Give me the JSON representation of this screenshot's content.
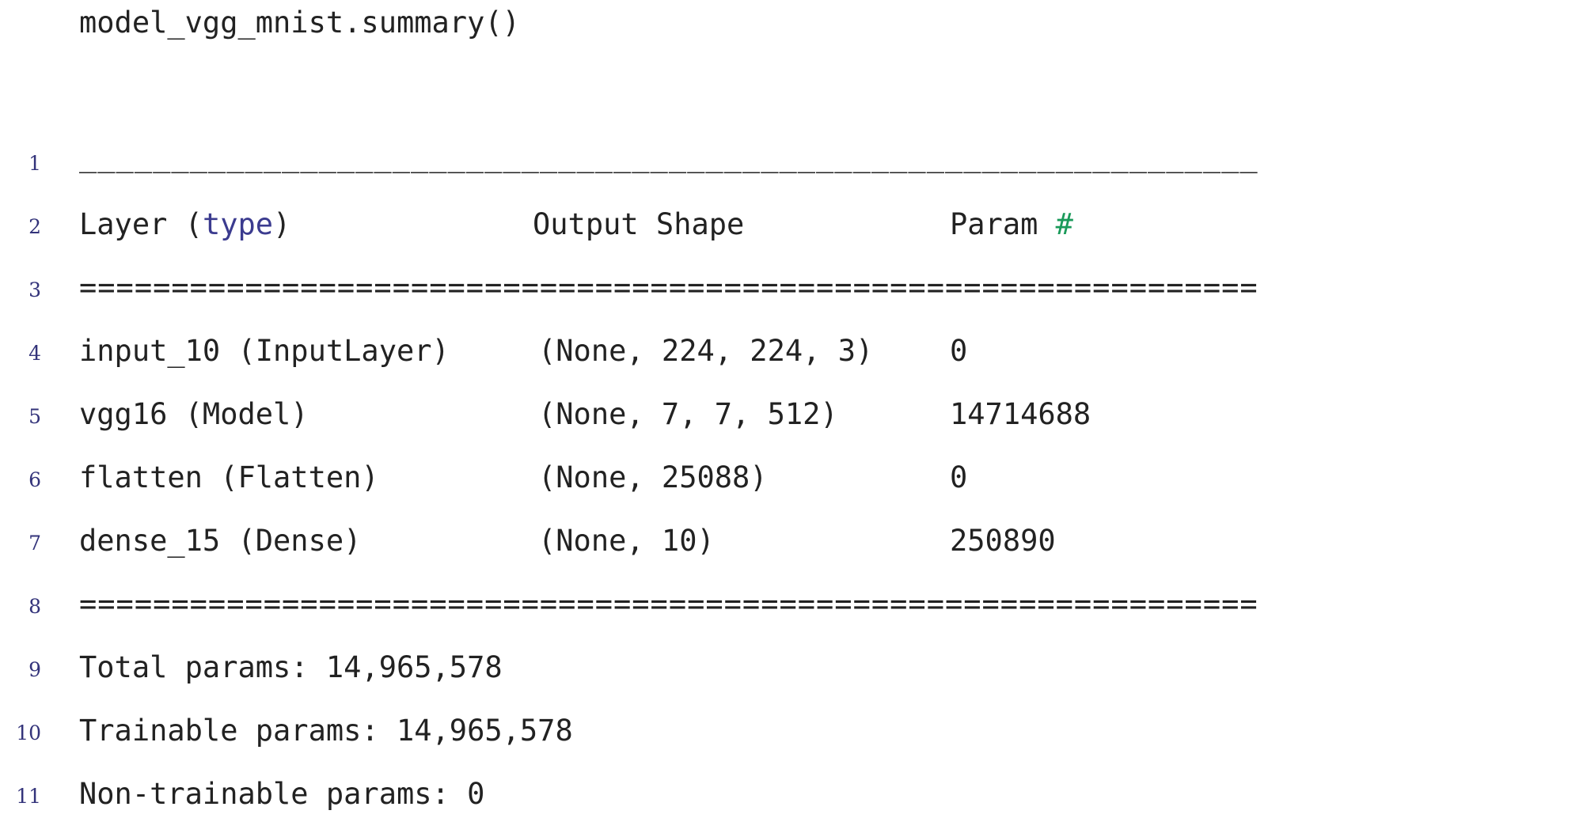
{
  "command": "model_vgg_mnist.summary()",
  "colors": {
    "text": "#222222",
    "line_number": "#33337a",
    "keyword": "#3b3b8f",
    "comment_hash": "#1a9a5a"
  },
  "listing": {
    "line_numbers": [
      "1",
      "2",
      "3",
      "4",
      "5",
      "6",
      "7",
      "8",
      "9",
      "10",
      "11"
    ],
    "separator_dash": "________________________________________________________________",
    "header": {
      "layer_prefix": "Layer (",
      "layer_kw": "type",
      "layer_suffix": ")",
      "output": "Output Shape",
      "param": "Param ",
      "param_hash": "#"
    },
    "separator_eq": "================================================================",
    "rows": [
      {
        "layer": "input_10 (InputLayer)",
        "output": "(None, 224, 224, 3)",
        "param": "0"
      },
      {
        "layer": "vgg16 (Model)",
        "output": "(None, 7, 7, 512)",
        "param": "14714688"
      },
      {
        "layer": "flatten (Flatten)",
        "output": "(None, 25088)",
        "param": "0"
      },
      {
        "layer": "dense_15 (Dense)",
        "output": "(None, 10)",
        "param": "250890"
      }
    ],
    "totals": {
      "total": "Total params: 14,965,578",
      "trainable": "Trainable params: 14,965,578",
      "non_trainable": "Non-trainable params: 0"
    }
  }
}
